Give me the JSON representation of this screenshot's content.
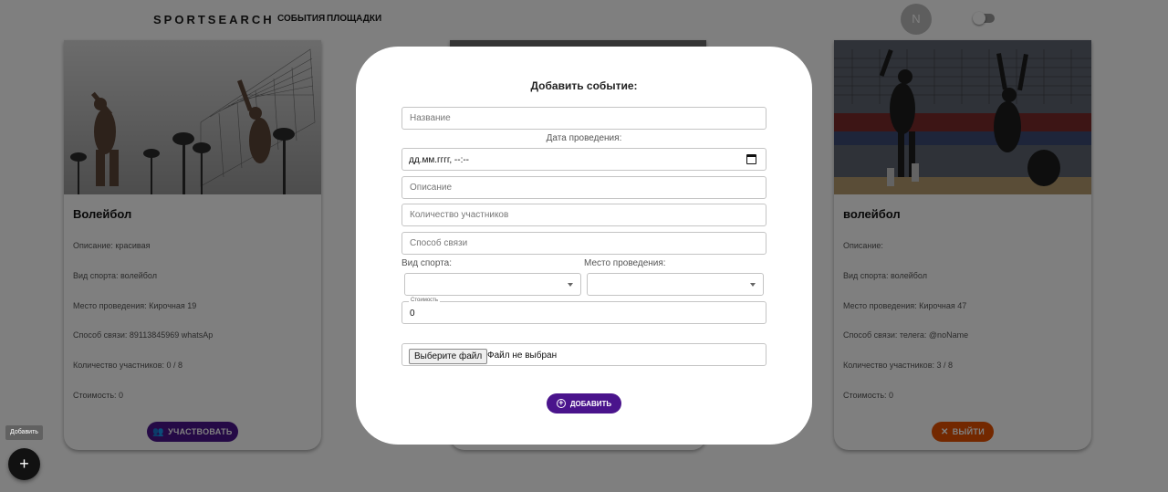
{
  "header": {
    "brand": "SPORTSEARCH",
    "nav": [
      "СОБЫТИЯ",
      "ПЛОЩАДКИ"
    ],
    "avatar_initial": "N"
  },
  "cards": [
    {
      "title": "Волейбол",
      "lines": [
        "Описание: красивая",
        "Вид спорта: волейбол",
        "Место проведения: Кирочная 19",
        "Способ связи: 89113845969 whatsAp",
        "Количество участников: 0 / 8",
        "Стоимость: 0"
      ],
      "button_label": "УЧАСТВОВАТЬ",
      "button_color": "#4a148c"
    },
    {
      "title": "волейбол",
      "lines": [
        "Описание:",
        "Вид спорта: волейбол",
        "Место проведения: Кирочная 47",
        "Способ связи: телега: @noName",
        "Количество участников: 3 / 8",
        "Стоимость: 0"
      ],
      "button_label": "ВЫЙТИ",
      "button_color": "#e65100"
    }
  ],
  "fab": {
    "tooltip": "Добавить",
    "icon": "plus-icon"
  },
  "modal": {
    "title": "Добавить событие:",
    "name_placeholder": "Название",
    "date_label": "Дата проведения:",
    "date_value": "дд.мм.гггг, --:--",
    "description_placeholder": "Описание",
    "participants_placeholder": "Количество участников",
    "contact_placeholder": "Способ связи",
    "sport_label": "Вид спорта:",
    "venue_label": "Место проведения:",
    "cost_label": "Стоимость",
    "cost_value": "0",
    "file_button": "Выберите файл",
    "file_status": "Файл не выбран",
    "submit_label": "ДОБАВИТЬ"
  },
  "colors": {
    "accent": "#4a148c",
    "exit": "#e65100",
    "overlay": "rgba(0,0,0,0.5)"
  }
}
